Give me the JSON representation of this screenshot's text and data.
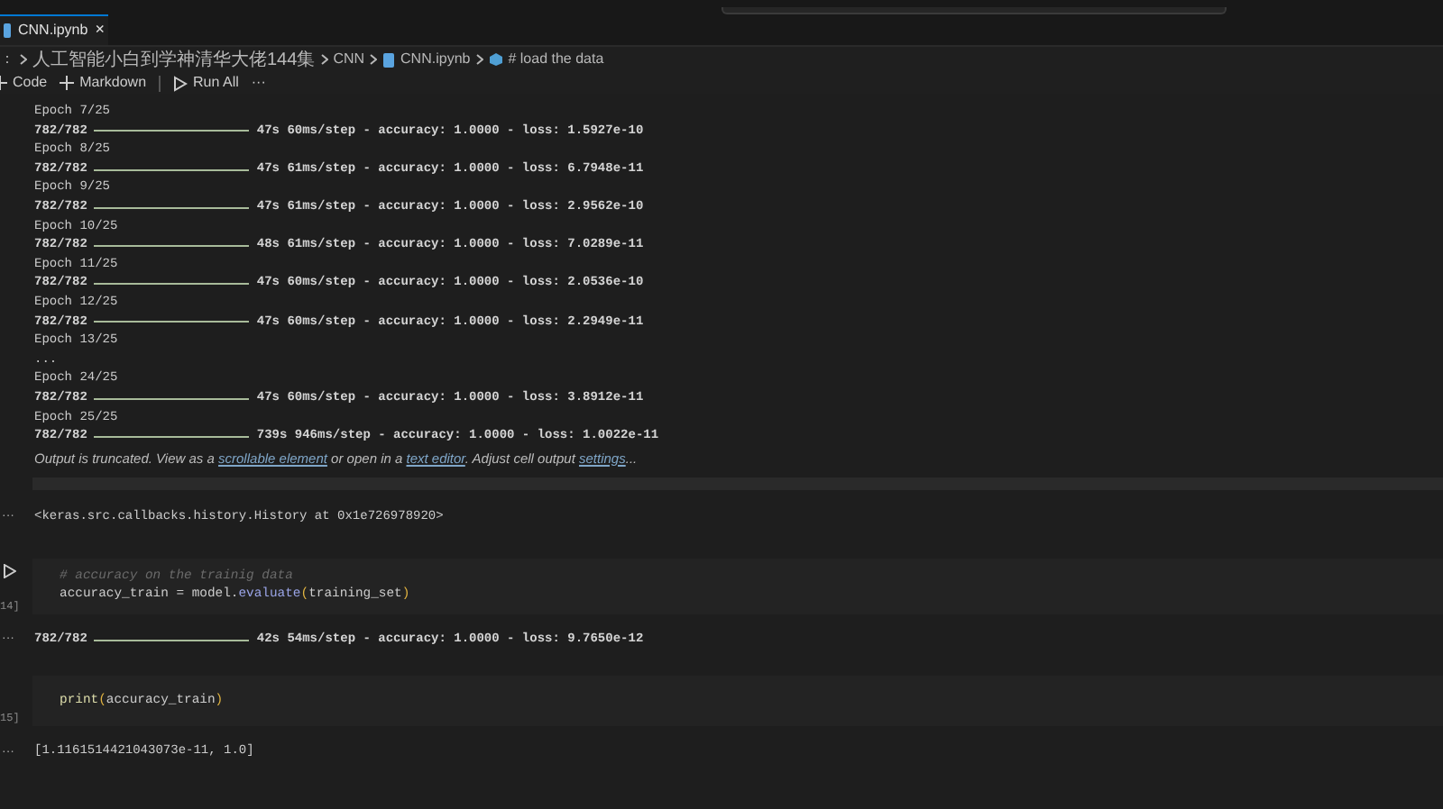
{
  "tab": {
    "title": "CNN.ipynb",
    "close": "×",
    "selected": true
  },
  "breadcrumb": [
    {
      "kind": "text",
      "label": "："
    },
    {
      "kind": "text",
      "label": "人工智能小白到学神清华大佬144集"
    },
    {
      "kind": "text",
      "label": "CNN"
    },
    {
      "kind": "file",
      "label": "CNN.ipynb"
    },
    {
      "kind": "cell",
      "label": "# load the data"
    }
  ],
  "toolbar": [
    {
      "kind": "code",
      "label": "Code"
    },
    {
      "kind": "markdown",
      "label": "Markdown"
    },
    {
      "kind": "run",
      "label": "Run All"
    },
    {
      "kind": "more",
      "label": "···"
    }
  ],
  "training_output": {
    "lines": [
      {
        "kind": "epoch",
        "text": "Epoch 7/25"
      },
      {
        "kind": "progress",
        "count": "782/782",
        "level": 1,
        "stats": "47s 60ms/step - accuracy: 1.0000 - loss: 1.5927e-10"
      },
      {
        "kind": "epoch",
        "text": "Epoch 8/25"
      },
      {
        "kind": "progress",
        "count": "782/782",
        "level": 1,
        "stats": "47s 61ms/step - accuracy: 1.0000 - loss: 6.7948e-11"
      },
      {
        "kind": "epoch",
        "text": "Epoch 9/25"
      },
      {
        "kind": "progress",
        "count": "782/782",
        "level": 1,
        "stats": "47s 61ms/step - accuracy: 1.0000 - loss: 2.9562e-10"
      },
      {
        "kind": "epoch",
        "text": "Epoch 10/25"
      },
      {
        "kind": "progress",
        "count": "782/782",
        "level": 1,
        "stats": "48s 61ms/step - accuracy: 1.0000 - loss: 7.0289e-11"
      },
      {
        "kind": "epoch",
        "text": "Epoch 11/25"
      },
      {
        "kind": "progress",
        "count": "782/782",
        "level": 1,
        "stats": "47s 60ms/step - accuracy: 1.0000 - loss: 2.0536e-10"
      },
      {
        "kind": "epoch",
        "text": "Epoch 12/25"
      },
      {
        "kind": "progress",
        "count": "782/782",
        "level": 1,
        "stats": "47s 60ms/step - accuracy: 1.0000 - loss: 2.2949e-11"
      },
      {
        "kind": "epoch",
        "text": "Epoch 13/25"
      },
      {
        "kind": "epoch",
        "text": "..."
      },
      {
        "kind": "epoch",
        "text": "Epoch 24/25"
      },
      {
        "kind": "progress",
        "count": "782/782",
        "level": 1,
        "stats": "47s 60ms/step - accuracy: 1.0000 - loss: 3.8912e-11"
      },
      {
        "kind": "epoch",
        "text": "Epoch 25/25"
      },
      {
        "kind": "progress",
        "count": "782/782",
        "level": 1,
        "stats": "739s 946ms/step - accuracy: 1.0000 - loss: 1.0022e-11"
      }
    ],
    "notice": [
      {
        "kind": "text",
        "text": "Output is truncated. View as a "
      },
      {
        "kind": "link",
        "text": "scrollable element"
      },
      {
        "kind": "text",
        "text": " or open in a "
      },
      {
        "kind": "link",
        "text": "text editor"
      },
      {
        "kind": "text",
        "text": ". Adjust cell output "
      },
      {
        "kind": "link",
        "text": "settings"
      },
      {
        "kind": "text",
        "text": "..."
      }
    ],
    "result_marker": "···",
    "result": "<keras.src.callbacks.history.History at 0x1e726978920>"
  },
  "cells": [
    {
      "number": "14]",
      "lines": [
        [
          {
            "kind": "comment",
            "text": "# accuracy on the trainig data"
          }
        ],
        [
          {
            "kind": "plain",
            "text": "accuracy_train = model."
          },
          {
            "kind": "method",
            "text": "evaluate"
          },
          {
            "kind": "paren",
            "text": "("
          },
          {
            "kind": "plain",
            "text": "training_set"
          },
          {
            "kind": "paren",
            "text": ")"
          }
        ]
      ],
      "output_marker": "···",
      "output": {
        "kind": "progress",
        "count": "782/782",
        "level": 1,
        "stats": "42s 54ms/step - accuracy: 1.0000 - loss: 9.7650e-12"
      }
    },
    {
      "number": "15]",
      "lines": [
        [
          {
            "kind": "function",
            "text": "print"
          },
          {
            "kind": "paren",
            "text": "("
          },
          {
            "kind": "plain",
            "text": "accuracy_train"
          },
          {
            "kind": "paren",
            "text": ")"
          }
        ]
      ],
      "output_marker": "···",
      "output": {
        "kind": "text",
        "text": "[1.1161514421043073e-11, 1.0]"
      }
    }
  ]
}
